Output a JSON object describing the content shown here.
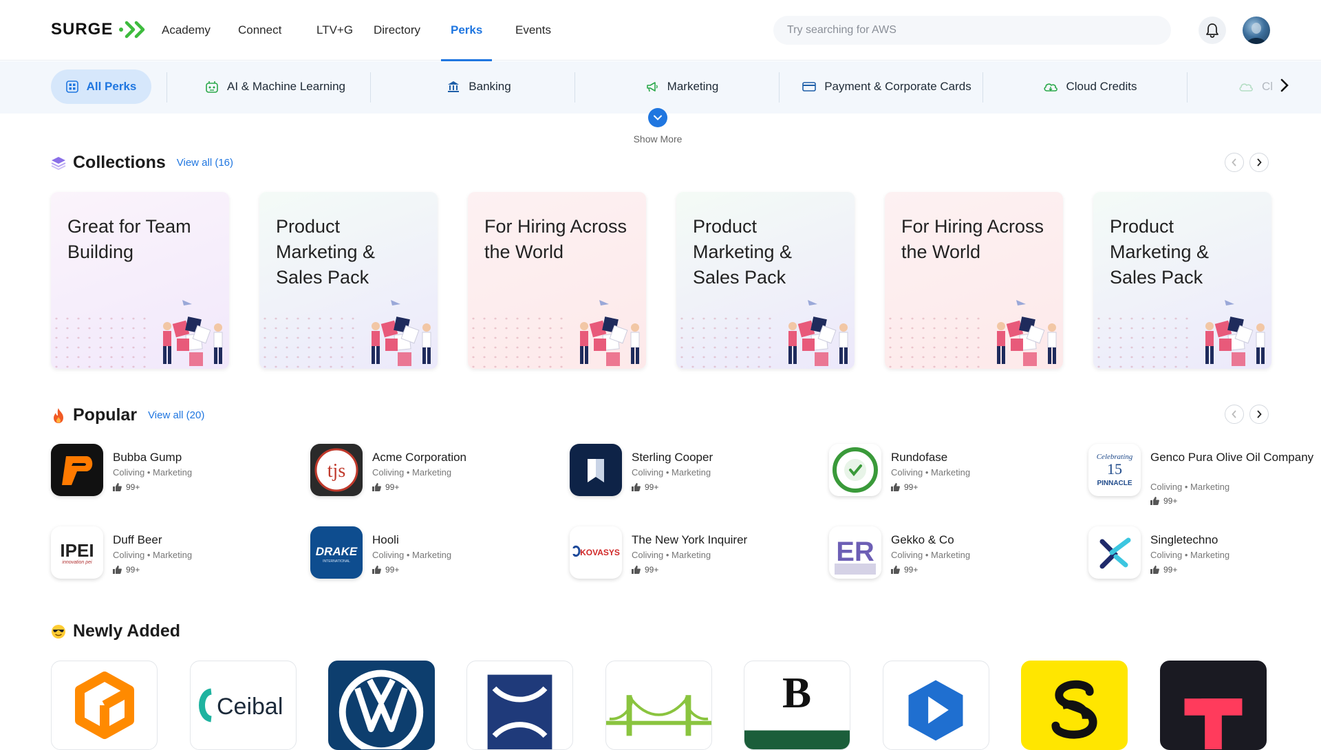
{
  "header": {
    "logo_text": "SURGE",
    "nav": [
      {
        "label": "Academy"
      },
      {
        "label": "Connect"
      },
      {
        "label": "LTV+G"
      },
      {
        "label": "Directory"
      },
      {
        "label": "Perks"
      },
      {
        "label": "Events"
      }
    ],
    "active_nav": "Perks",
    "search_placeholder": "Try searching for AWS"
  },
  "categories": {
    "items": [
      {
        "label": "All Perks",
        "icon": "grid-icon"
      },
      {
        "label": "AI & Machine Learning",
        "icon": "robot-icon"
      },
      {
        "label": "Banking",
        "icon": "bank-icon"
      },
      {
        "label": "Marketing",
        "icon": "megaphone-icon"
      },
      {
        "label": "Payment & Corporate Cards",
        "icon": "credit-card-icon"
      },
      {
        "label": "Cloud Credits",
        "icon": "cloud-icon"
      },
      {
        "label": "Cl",
        "icon": "cloud-icon"
      }
    ],
    "active": "All Perks",
    "show_more_label": "Show More"
  },
  "collections": {
    "title": "Collections",
    "view_all": "View all (16)",
    "cards": [
      {
        "title": "Great for Team Building"
      },
      {
        "title": "Product Marketing & Sales Pack"
      },
      {
        "title": "For Hiring Across the World"
      },
      {
        "title": "Product Marketing & Sales Pack"
      },
      {
        "title": "For Hiring Across the World"
      },
      {
        "title": "Product Marketing & Sales Pack"
      }
    ]
  },
  "popular": {
    "title": "Popular",
    "view_all": "View all (20)",
    "items": [
      {
        "name": "Bubba Gump",
        "tags": "Coliving • Marketing",
        "likes": "99+"
      },
      {
        "name": "Acme Corporation",
        "tags": "Coliving • Marketing",
        "likes": "99+"
      },
      {
        "name": "Sterling Cooper",
        "tags": "Coliving • Marketing",
        "likes": "99+"
      },
      {
        "name": "Rundofase",
        "tags": "Coliving • Marketing",
        "likes": "99+"
      },
      {
        "name": "Genco Pura Olive Oil Company",
        "tags": "Coliving • Marketing",
        "likes": "99+"
      },
      {
        "name": "Duff Beer",
        "tags": "Coliving • Marketing",
        "likes": "99+"
      },
      {
        "name": "Hooli",
        "tags": "Coliving • Marketing",
        "likes": "99+"
      },
      {
        "name": "The New York Inquirer",
        "tags": "Coliving • Marketing",
        "likes": "99+"
      },
      {
        "name": "Gekko & Co",
        "tags": "Coliving • Marketing",
        "likes": "99+"
      },
      {
        "name": "Singletechno",
        "tags": "Coliving • Marketing",
        "likes": "99+"
      }
    ],
    "logo_texts": {
      "acme": "tjs",
      "genco_line1": "Celebrating",
      "genco_line2": "15",
      "genco_line3": "PINNACLE",
      "duff": "IPEI",
      "duff_sub": "innovation pei",
      "hooli": "DRAKE",
      "hooli_sub": "INTERNATIONAL",
      "nyi": "KOVASYS",
      "gekko": "ER"
    }
  },
  "newly_added": {
    "title": "Newly Added",
    "items": [
      {
        "name": "orange-box-logo"
      },
      {
        "name": "ceibal-logo",
        "text": "Ceibal"
      },
      {
        "name": "volkswagen-logo"
      },
      {
        "name": "blue-arc-logo"
      },
      {
        "name": "bridge-logo"
      },
      {
        "name": "b150-logo",
        "text": "B"
      },
      {
        "name": "play-hex-logo"
      },
      {
        "name": "yellow-s-logo"
      },
      {
        "name": "red-t-logo"
      }
    ]
  },
  "colors": {
    "accent": "#1f76e0",
    "active_pill": "#d6e7fb",
    "category_bar": "#f3f7fc"
  }
}
